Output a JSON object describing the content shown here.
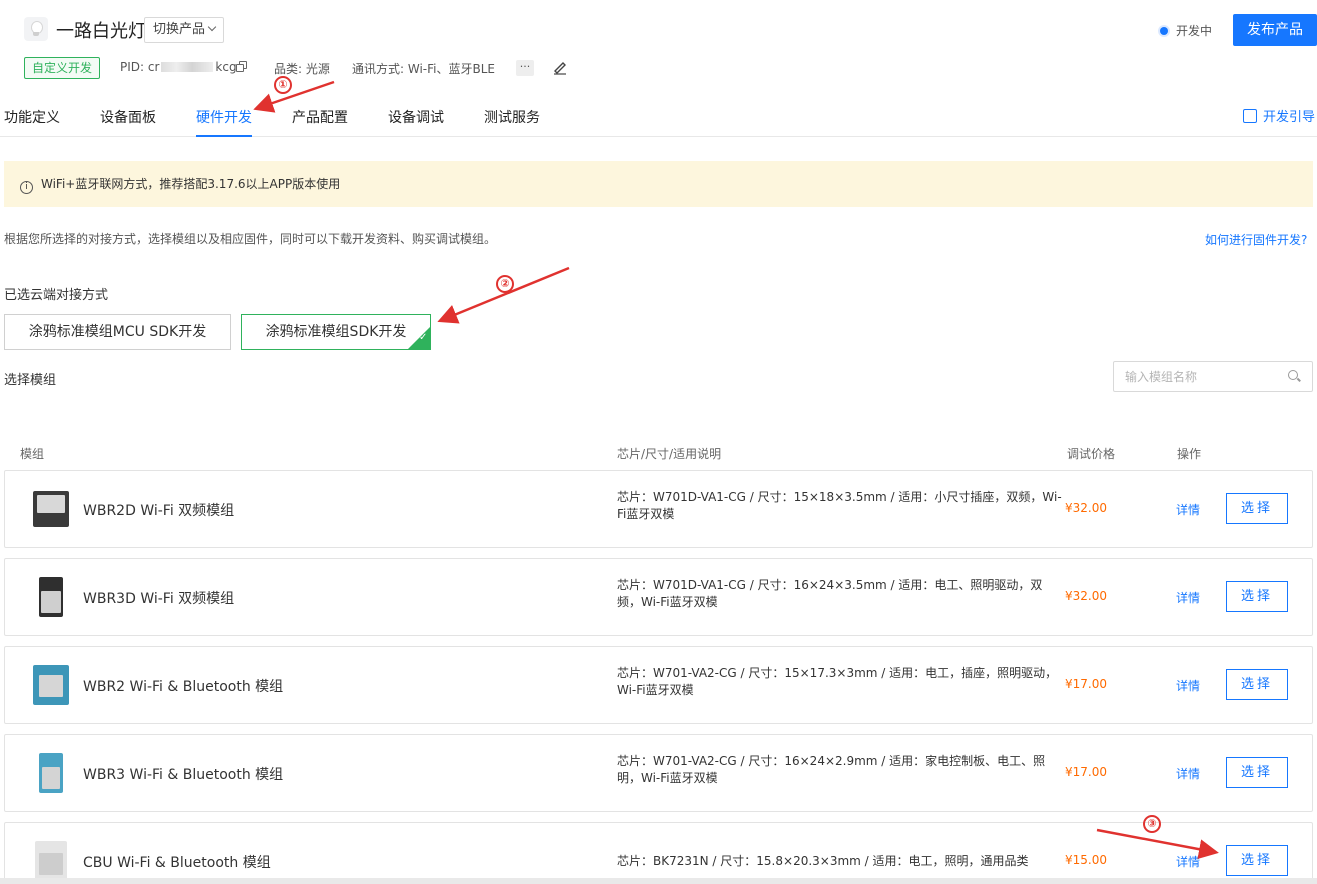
{
  "header": {
    "product_title": "一路白光灯",
    "switch_label": "切换产品",
    "status": "开发中",
    "publish_label": "发布产品",
    "custom_tag": "自定义开发",
    "pid_label": "PID: cr",
    "pid_tail": "kcg",
    "category": "品类: 光源",
    "protocol": "通讯方式: Wi-Fi、蓝牙BLE",
    "more": "···"
  },
  "tabs": [
    {
      "label": "功能定义"
    },
    {
      "label": "设备面板"
    },
    {
      "label": "硬件开发"
    },
    {
      "label": "产品配置"
    },
    {
      "label": "设备调试"
    },
    {
      "label": "测试服务"
    }
  ],
  "guide_label": "开发引导",
  "alert_text": "WiFi+蓝牙联网方式，推荐搭配3.17.6以上APP版本使用",
  "description": "根据您所选择的对接方式，选择模组以及相应固件，同时可以下载开发资料、购买调试模组。",
  "howto_link": "如何进行固件开发?",
  "cloud_section_label": "已选云端对接方式",
  "cloud_options": [
    {
      "label": "涂鸦标准模组MCU SDK开发"
    },
    {
      "label": "涂鸦标准模组SDK开发"
    }
  ],
  "module_section_label": "选择模组",
  "search": {
    "placeholder": "输入模组名称"
  },
  "table": {
    "headers": [
      "模组",
      "芯片/尺寸/适用说明",
      "调试价格",
      "操作"
    ],
    "rows": [
      {
        "name": "WBR2D Wi-Fi 双频模组",
        "chip": "芯片：W701D-VA1-CG / 尺寸：15×18×3.5mm / 适用：小尺寸插座，双频，Wi-Fi蓝牙双模",
        "price": "¥32.00",
        "detail": "详情",
        "choose": "选择"
      },
      {
        "name": "WBR3D Wi-Fi 双频模组",
        "chip": "芯片：W701D-VA1-CG / 尺寸：16×24×3.5mm / 适用：电工、照明驱动，双频，Wi-Fi蓝牙双模",
        "price": "¥32.00",
        "detail": "详情",
        "choose": "选择"
      },
      {
        "name": "WBR2 Wi-Fi & Bluetooth 模组",
        "chip": "芯片：W701-VA2-CG / 尺寸：15×17.3×3mm / 适用：电工，插座，照明驱动，Wi-Fi蓝牙双模",
        "price": "¥17.00",
        "detail": "详情",
        "choose": "选择"
      },
      {
        "name": "WBR3 Wi-Fi & Bluetooth 模组",
        "chip": "芯片：W701-VA2-CG / 尺寸：16×24×2.9mm / 适用：家电控制板、电工、照明，Wi-Fi蓝牙双模",
        "price": "¥17.00",
        "detail": "详情",
        "choose": "选择"
      },
      {
        "name": "CBU Wi-Fi & Bluetooth 模组",
        "chip": "芯片：BK7231N / 尺寸：15.8×20.3×3mm / 适用：电工，照明，通用品类",
        "price": "¥15.00",
        "detail": "详情",
        "choose": "选择"
      }
    ]
  },
  "annotations": [
    "①",
    "②",
    "③"
  ],
  "colors": {
    "accent": "#1677ff",
    "success": "#2fb25c",
    "price": "#ff6a00",
    "annotation": "#e0322f",
    "alert_bg": "#fdf6dd"
  },
  "icons": [
    "bulb-icon",
    "chevron-down-icon",
    "copy-icon",
    "more-icon",
    "edit-icon",
    "guide-icon",
    "info-icon",
    "check-icon",
    "search-icon"
  ]
}
